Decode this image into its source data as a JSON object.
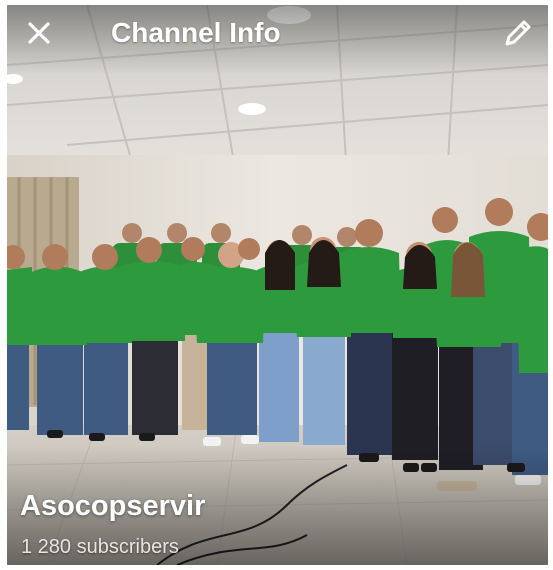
{
  "header": {
    "title": "Channel Info",
    "close_icon": "close-icon",
    "edit_icon": "pencil-icon"
  },
  "channel": {
    "name": "Asocopservir",
    "subscribers": "1 280 subscribers"
  },
  "colors": {
    "shirt_green": "#2e9a3e",
    "jeans_blue": "#4a6a93",
    "wall": "#e9e4dc",
    "ceiling": "#d9d6d0",
    "floor": "#cfcac0",
    "text": "#ffffff"
  }
}
